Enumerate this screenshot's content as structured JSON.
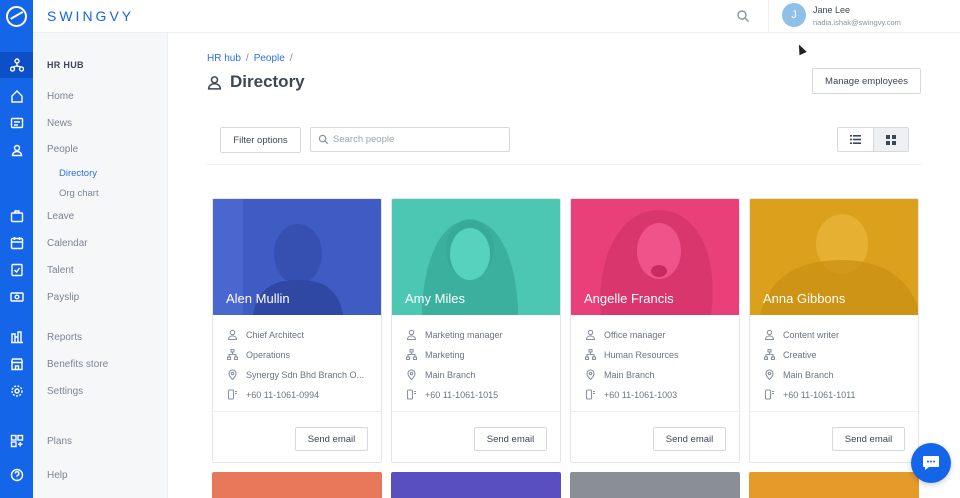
{
  "brand": "SWINGVY",
  "sidebar": {
    "section": "HR HUB",
    "items": [
      {
        "label": "Home"
      },
      {
        "label": "News"
      },
      {
        "label": "People"
      },
      {
        "label": "Directory"
      },
      {
        "label": "Org chart"
      },
      {
        "label": "Leave"
      },
      {
        "label": "Calendar"
      },
      {
        "label": "Talent"
      },
      {
        "label": "Payslip"
      },
      {
        "label": "Reports"
      },
      {
        "label": "Benefits store"
      },
      {
        "label": "Settings"
      },
      {
        "label": "Plans"
      },
      {
        "label": "Help"
      }
    ]
  },
  "user": {
    "initial": "J",
    "name": "Jane Lee",
    "email": "nadia.ishak@swingvy.com"
  },
  "breadcrumb": {
    "level1": "HR hub",
    "level2": "People",
    "sep": "/"
  },
  "page": {
    "title": "Directory",
    "manage_label": "Manage employees"
  },
  "toolbar": {
    "filter_label": "Filter options",
    "search_placeholder": "Search people"
  },
  "colors": {
    "accent": "#1565e8",
    "blue_card": "#3f5bc4",
    "teal_card": "#4cc7b4",
    "pink_card": "#e9407a",
    "gold_card": "#dba11c"
  },
  "cards": [
    {
      "name": "Alen Mullin",
      "title": "Chief Architect",
      "dept": "Operations",
      "branch": "Synergy Sdn Bhd Branch O...",
      "phone": "+60 11-1061-0994",
      "email_label": "Send email"
    },
    {
      "name": "Amy Miles",
      "title": "Marketing manager",
      "dept": "Marketing",
      "branch": "Main Branch",
      "phone": "+60 11-1061-1015",
      "email_label": "Send email"
    },
    {
      "name": "Angelle Francis",
      "title": "Office manager",
      "dept": "Human Resources",
      "branch": "Main Branch",
      "phone": "+60 11-1061-1003",
      "email_label": "Send email"
    },
    {
      "name": "Anna Gibbons",
      "title": "Content writer",
      "dept": "Creative",
      "branch": "Main Branch",
      "phone": "+60 11-1061-1011",
      "email_label": "Send email"
    }
  ]
}
